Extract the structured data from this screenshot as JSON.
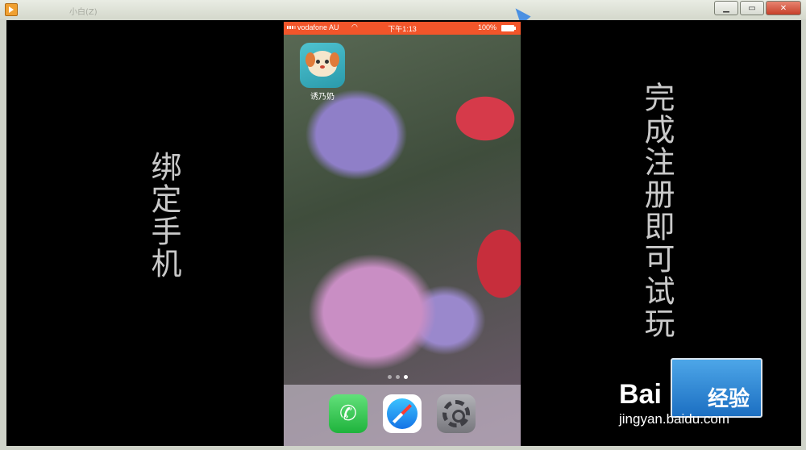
{
  "window": {
    "ghost_title": "小白(Z)"
  },
  "window_buttons": {
    "minimize": "▁",
    "maximize": "▭",
    "close": "✕"
  },
  "left_caption": "绑定手机",
  "right_caption": "完成注册即可试玩",
  "phone": {
    "carrier": "vodafone AU",
    "time": "下午1:13",
    "battery": "100%",
    "top_app_label": "诱乃奶",
    "dock_apps": [
      "phone",
      "safari",
      "settings"
    ]
  },
  "watermark": {
    "brand": "Bai",
    "jingyan": "经验",
    "url": "jingyan.baidu.com"
  },
  "colors": {
    "statusbar": "#f2552a",
    "background": "#000000"
  }
}
